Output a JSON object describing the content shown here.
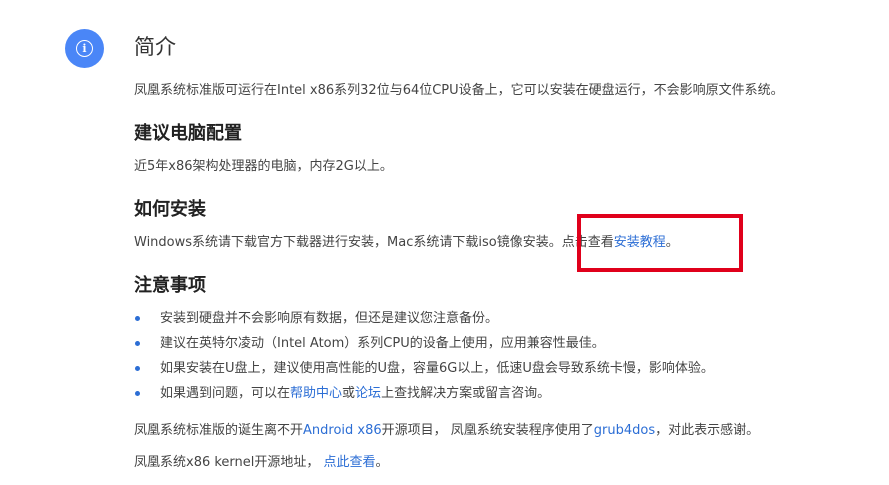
{
  "icon": "info-icon",
  "title": "简介",
  "intro": "凤凰系统标准版可运行在Intel x86系列32位与64位CPU设备上，它可以安装在硬盘运行，不会影响原文件系统。",
  "config": {
    "heading": "建议电脑配置",
    "text": "近5年x86架构处理器的电脑，内存2G以上。"
  },
  "install": {
    "heading": "如何安装",
    "text": "Windows系统请下载官方下载器进行安装，Mac系统请下载iso镜像安装。点击查看",
    "link": "安装教程",
    "suffix": "。"
  },
  "notes": {
    "heading": "注意事项",
    "items": [
      "安装到硬盘并不会影响原有数据，但还是建议您注意备份。",
      "建议在英特尔凌动（Intel Atom）系列CPU的设备上使用，应用兼容性最佳。",
      "如果安装在U盘上，建议使用高性能的U盘，容量6G以上，低速U盘会导致系统卡慢，影响体验。"
    ],
    "item4": {
      "prefix": "如果遇到问题，可以在",
      "link1": "帮助中心",
      "mid": "或",
      "link2": "论坛",
      "suffix": "上查找解决方案或留言咨询。"
    }
  },
  "credits": {
    "prefix": "凤凰系统标准版的诞生离不开",
    "link1": "Android x86",
    "mid": "开源项目， 凤凰系统安装程序使用了",
    "link2": "grub4dos",
    "suffix": "，对此表示感谢。"
  },
  "source": {
    "prefix": "凤凰系统x86 kernel开源地址， ",
    "link": "点此查看",
    "suffix": "。"
  },
  "colors": {
    "accent": "#4a86f7",
    "link": "#2c6ed5",
    "highlight": "#e0001b"
  }
}
